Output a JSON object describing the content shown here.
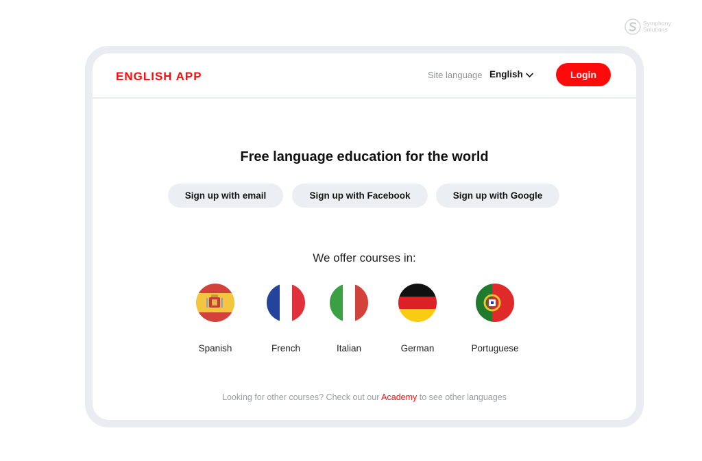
{
  "watermark": {
    "line1": "Symphony",
    "line2": "Solutions"
  },
  "header": {
    "brand": "ENGLISH APP",
    "site_language_label": "Site language",
    "site_language_value": "English",
    "login_label": "Login",
    "accent_color": "#ff0a0a"
  },
  "hero": {
    "headline": "Free language education for the world",
    "signup_buttons": [
      {
        "label": "Sign up with email"
      },
      {
        "label": "Sign up with Facebook"
      },
      {
        "label": "Sign up with Google"
      }
    ]
  },
  "courses": {
    "heading": "We offer courses in:",
    "items": [
      {
        "label": "Spanish",
        "flag": "spain-flag-icon"
      },
      {
        "label": "French",
        "flag": "france-flag-icon"
      },
      {
        "label": "Italian",
        "flag": "italy-flag-icon"
      },
      {
        "label": "German",
        "flag": "germany-flag-icon"
      },
      {
        "label": "Portuguese",
        "flag": "portugal-flag-icon"
      }
    ]
  },
  "footer": {
    "before": "Looking for other courses? Check out our ",
    "link": "Academy",
    "after": " to see other languages"
  }
}
